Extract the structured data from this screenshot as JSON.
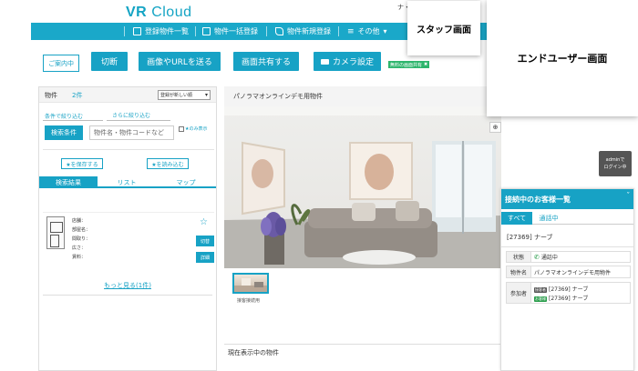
{
  "header": {
    "logo": "VR Cloud",
    "logo_primary": "VR",
    "logo_secondary": "Cloud",
    "topright_text": "ナ・"
  },
  "nav": {
    "items": [
      {
        "label": "登録物件一覧",
        "icon": "list-icon"
      },
      {
        "label": "物件一括登録",
        "icon": "upload-icon"
      },
      {
        "label": "物件新規登録",
        "icon": "pencil-icon"
      },
      {
        "label": "その他",
        "icon": "menu-icon"
      }
    ],
    "dropdown_arrow": "▾"
  },
  "buttons": {
    "guide": "ご案内中",
    "cut": "切断",
    "send_image_url": "画像やURLを送る",
    "share_screen": "画面共有する",
    "camera_settings": "カメラ設定",
    "trial_badge": "無料の画面共有",
    "trial_badge_icon": "✖"
  },
  "overlays": {
    "staff": "スタッフ画面",
    "end_user": "エンドユーザー画面"
  },
  "left_panel": {
    "title": "物件",
    "count": "2件",
    "sort_selected": "登録が新しい順",
    "link_filter": "条件で絞り込む",
    "link_narrow": "さらに絞り込む",
    "search_button": "検索条件",
    "search_placeholder": "物件名・物件コードなど",
    "only_star": "★のみ表示",
    "save_star": "★を保存する",
    "load_star": "★を読み込む",
    "tabs": [
      "検索結果",
      "リスト",
      "マップ"
    ],
    "property": {
      "fields": [
        "店舗：",
        "部屋名：",
        "間取り：",
        "広さ：",
        "賃料："
      ],
      "star": "☆",
      "switch_button": "切替",
      "detail_button": "詳細"
    },
    "more_link": "もっと見る(1件)"
  },
  "center": {
    "title": "パノラマオンラインデモ用物件",
    "thumb_label": "接客接続用",
    "zoom_icon": "⊕",
    "current_label": "現在表示中の物件"
  },
  "admin_badge": {
    "line1": "adminで",
    "line2": "ログイン中"
  },
  "client_panel": {
    "title": "接続中のお客様一覧",
    "caret": "ˇ",
    "tabs": [
      "すべて",
      "通話中"
    ],
    "customer": "[27369] ナーブ",
    "status_label": "状態",
    "status_value": "通話中",
    "property_label": "物件名",
    "property_value": "パノラマオンラインデモ用物件",
    "participants_label": "参加者",
    "participants": [
      {
        "role": "接客者",
        "role_color": "#555555",
        "text": "[27369] ナーブ"
      },
      {
        "role": "お客様",
        "role_color": "#2a9d4b",
        "text": "[27369] ナーブ"
      }
    ]
  },
  "colors": {
    "accent": "#17a2c5",
    "nav": "#1aa8c9",
    "green": "#2db56c"
  }
}
